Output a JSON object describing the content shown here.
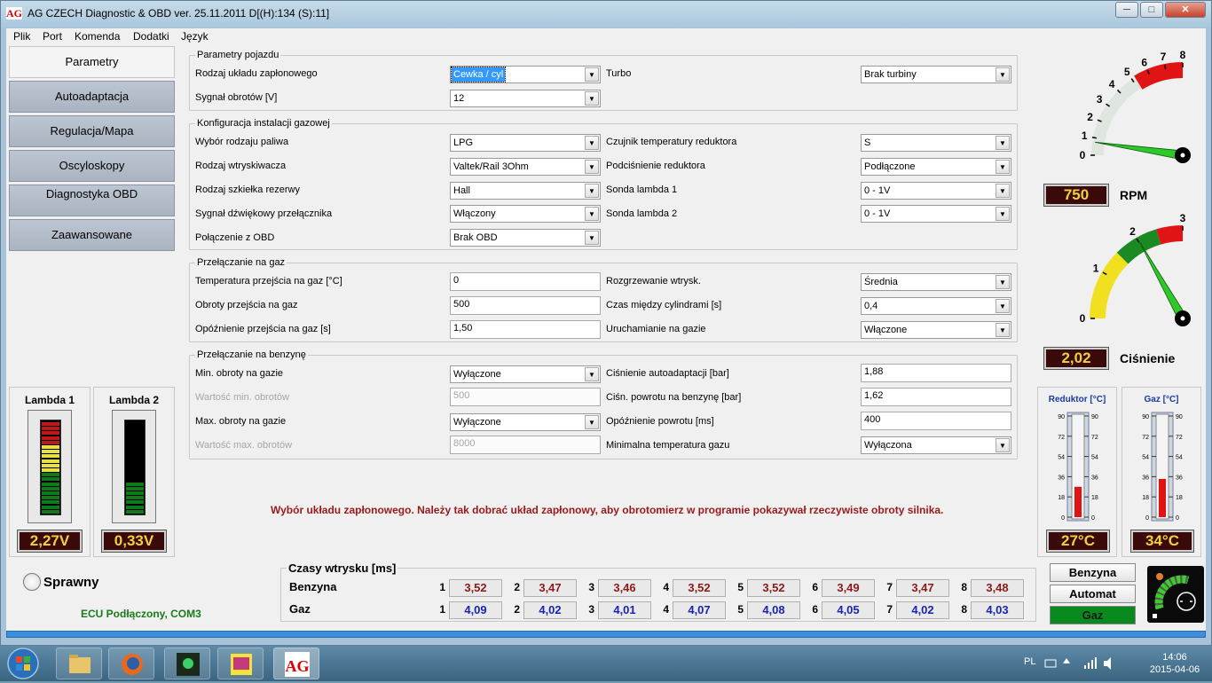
{
  "window": {
    "title": "AG CZECH Diagnostic & OBD ver.  25.11.2011 D[(H):134 (S):11]",
    "logo": "AG",
    "minimize": "─",
    "maximize": "□",
    "close": "✕"
  },
  "menu": [
    "Plik",
    "Port",
    "Komenda",
    "Dodatki",
    "Język"
  ],
  "nav": [
    {
      "label": "Parametry",
      "active": true
    },
    {
      "label": "Autoadaptacja",
      "active": false
    },
    {
      "label": "Regulacja/Mapa",
      "active": false
    },
    {
      "label": "Oscyloskopy",
      "active": false
    },
    {
      "label": "Diagnostyka OBD",
      "active": false
    },
    {
      "label": "Zaawansowane",
      "active": false
    }
  ],
  "vehicle": {
    "title": "Parametry pojazdu",
    "ignition_label": "Rodzaj układu zapłonowego",
    "ignition_value": "Cewka / cyl",
    "rpm_signal_label": "Sygnał obrotów [V]",
    "rpm_signal_value": "12",
    "turbo_label": "Turbo",
    "turbo_value": "Brak turbiny"
  },
  "gas_config": {
    "title": "Konfiguracja instalacji gazowej",
    "fuel_label": "Wybór rodzaju paliwa",
    "fuel_value": "LPG",
    "injector_label": "Rodzaj wtryskiwacza",
    "injector_value": "Valtek/Rail 3Ohm",
    "reserve_label": "Rodzaj szkiełka rezerwy",
    "reserve_value": "Hall",
    "sound_label": "Sygnał dźwiękowy przełącznika",
    "sound_value": "Włączony",
    "obd_label": "Połączenie z OBD",
    "obd_value": "Brak OBD",
    "reducer_temp_label": "Czujnik temperatury reduktora",
    "reducer_temp_value": "S",
    "vacuum_label": "Podciśnienie reduktora",
    "vacuum_value": "Podłączone",
    "lambda1_label": "Sonda lambda 1",
    "lambda1_value": "0 - 1V",
    "lambda2_label": "Sonda lambda 2",
    "lambda2_value": "0 - 1V"
  },
  "to_gas": {
    "title": "Przełączanie na gaz",
    "temp_label": "Temperatura przejścia na gaz [°C]",
    "temp_value": "0",
    "rpm_label": "Obroty przejścia na gaz",
    "rpm_value": "500",
    "delay_label": "Opóźnienie przejścia na gaz [s]",
    "delay_value": "1,50",
    "warmup_label": "Rozgrzewanie wtrysk.",
    "warmup_value": "Średnia",
    "cyl_time_label": "Czas między cylindrami [s]",
    "cyl_time_value": "0,4",
    "start_label": "Uruchamianie na gazie",
    "start_value": "Włączone"
  },
  "to_petrol": {
    "title": "Przełączanie na benzynę",
    "min_rpm_label": "Min. obroty na gazie",
    "min_rpm_value": "Wyłączone",
    "min_val_label": "Wartość min. obrotów",
    "min_val_value": "500",
    "max_rpm_label": "Max. obroty na gazie",
    "max_rpm_value": "Wyłączone",
    "max_val_label": "Wartość max. obrotów",
    "max_val_value": "8000",
    "autoadapt_label": "Ciśnienie autoadaptacji [bar]",
    "autoadapt_value": "1,88",
    "return_label": "Ciśn. powrotu na benzynę [bar]",
    "return_value": "1,62",
    "return_delay_label": "Opóźnienie powrotu [ms]",
    "return_delay_value": "400",
    "min_gas_temp_label": "Minimalna temperatura gazu",
    "min_gas_temp_value": "Wyłączona"
  },
  "hint": "Wybór układu zapłonowego. Należy tak dobrać układ zapłonowy, aby obrotomierz w programie pokazywał rzeczywiste obroty silnika.",
  "rpm_gauge": {
    "ticks": [
      "0",
      "1",
      "2",
      "3",
      "4",
      "5",
      "6",
      "7",
      "8"
    ],
    "value_display": "750",
    "label": "RPM",
    "value": 0.75
  },
  "pressure_gauge": {
    "ticks": [
      "0",
      "1",
      "2",
      "3"
    ],
    "value_display": "2,02",
    "label": "Ciśnienie",
    "value": 2.02
  },
  "lambda1": {
    "title": "Lambda 1",
    "value": "2,27V"
  },
  "lambda2": {
    "title": "Lambda 2",
    "value": "0,33V"
  },
  "reducer_temp": {
    "title": "Reduktor [°C]",
    "value": "27°C",
    "level": 27,
    "ticks": [
      "90",
      "72",
      "54",
      "36",
      "18",
      "0"
    ]
  },
  "gas_temp": {
    "title": "Gaz [°C]",
    "value": "34°C",
    "level": 34,
    "ticks": [
      "90",
      "72",
      "54",
      "36",
      "18",
      "0"
    ]
  },
  "status": {
    "ok_label": "Sprawny",
    "ecu": "ECU Podłączony, COM3"
  },
  "injection_times": {
    "title": "Czasy wtrysku [ms]",
    "petrol_label": "Benzyna",
    "gas_label": "Gaz",
    "numbers": [
      "1",
      "2",
      "3",
      "4",
      "5",
      "6",
      "7",
      "8"
    ],
    "petrol": [
      "3,52",
      "3,47",
      "3,46",
      "3,52",
      "3,52",
      "3,49",
      "3,47",
      "3,48"
    ],
    "gas": [
      "4,09",
      "4,02",
      "4,01",
      "4,07",
      "4,08",
      "4,05",
      "4,02",
      "4,03"
    ]
  },
  "fuel_switch": {
    "petrol": "Benzyna",
    "auto": "Automat",
    "gas": "Gaz"
  },
  "taskbar": {
    "lang": "PL",
    "time": "14:06",
    "date": "2015-04-06"
  },
  "colors": {
    "digit_bg": "#3a0a0a",
    "digit_fg": "#f2d03c",
    "hint": "#9a1a1a",
    "petrol_text": "#8a1a1a",
    "gas_text": "#1a24b0",
    "gas_active": "#0a8a1e"
  }
}
